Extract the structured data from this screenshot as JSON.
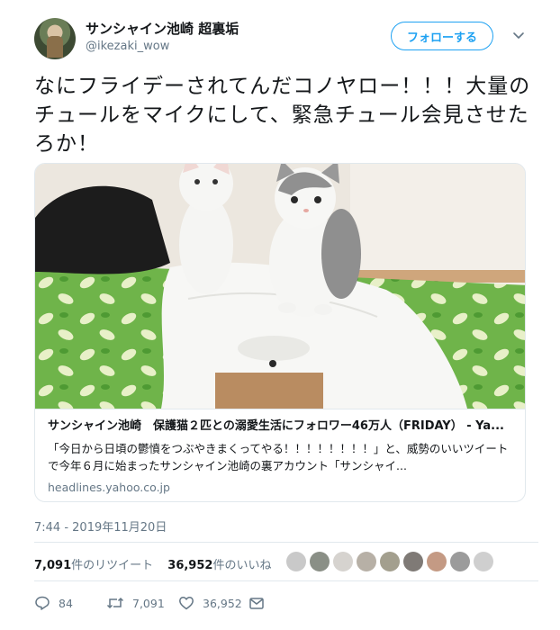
{
  "user": {
    "display_name": "サンシャイン池崎 超裏垢",
    "handle": "@ikezaki_wow"
  },
  "follow_button_label": "フォローする",
  "tweet_text": "なにフライデーされてんだコノヤロー！！！大量のチュールをマイクにして、緊急チュール会見させたろか！",
  "card": {
    "title": "サンシャイン池崎　保護猫２匹との溺愛生活にフォロワー46万人（FRIDAY） - Ya...",
    "description": "「今日から日頃の鬱憤をつぶやきまくってやる！！！！！！！！」と、威勢のいいツイートで今年６月に始まったサンシャイン池崎の裏アカウント「サンシャイ...",
    "domain": "headlines.yahoo.co.jp"
  },
  "timestamp": "7:44 - 2019年11月20日",
  "stats": {
    "retweets_count": "7,091",
    "retweets_label": "件のリツイート",
    "likes_count": "36,952",
    "likes_label": "件のいいね"
  },
  "actions": {
    "reply_count": "84",
    "retweet_count": "7,091",
    "like_count": "36,952"
  },
  "colors": {
    "accent": "#1da1f2",
    "muted_text": "#657786",
    "border": "#e1e8ed"
  }
}
